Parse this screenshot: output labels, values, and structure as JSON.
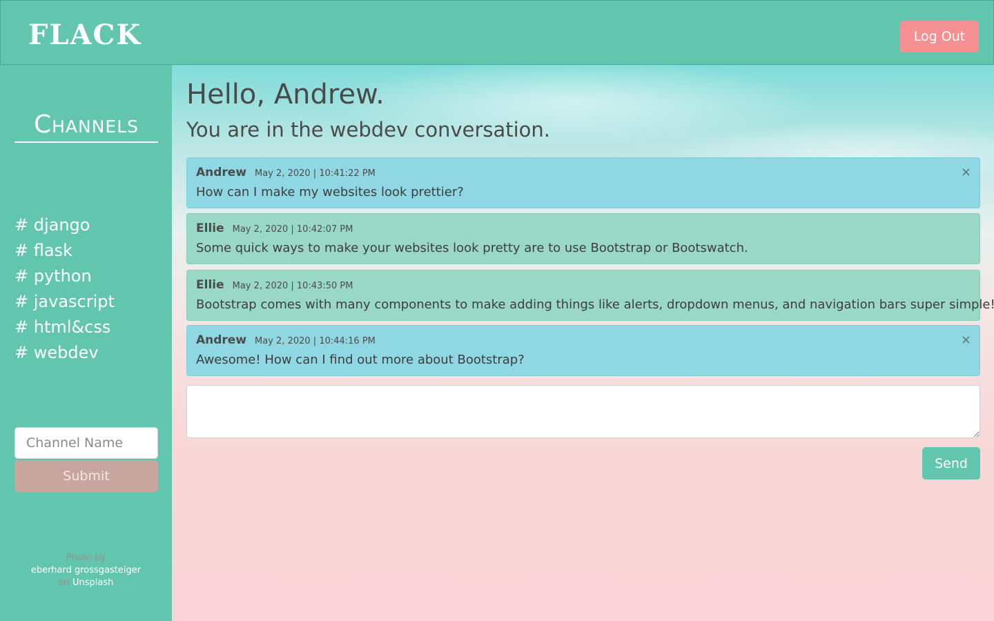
{
  "header": {
    "brand": "FLACK",
    "logout_label": "Log Out"
  },
  "sidebar": {
    "heading": "Channels",
    "channels": [
      "# django",
      "# flask",
      "# python",
      "# javascript",
      "# html&css",
      "# webdev"
    ],
    "channel_input_placeholder": "Channel Name",
    "submit_label": "Submit",
    "credit": {
      "photo_by": "Photo by",
      "author": "eberhard grossgasteiger",
      "on": "on",
      "source": "Unsplash"
    }
  },
  "main": {
    "greeting": "Hello, Andrew.",
    "subtitle": "You are in the webdev conversation.",
    "messages": [
      {
        "user": "Andrew",
        "time": "May 2, 2020 | 10:41:22 PM",
        "text": "How can I make my websites look prettier?",
        "own": true
      },
      {
        "user": "Ellie",
        "time": "May 2, 2020 | 10:42:07 PM",
        "text": "Some quick ways to make your websites look pretty are to use Bootstrap or Bootswatch.",
        "own": false
      },
      {
        "user": "Ellie",
        "time": "May 2, 2020 | 10:43:50 PM",
        "text": "Bootstrap comes with many components to make adding things like alerts, dropdown menus, and navigation bars super simple!",
        "own": false
      },
      {
        "user": "Andrew",
        "time": "May 2, 2020 | 10:44:16 PM",
        "text": "Awesome! How can I find out more about Bootstrap?",
        "own": true
      }
    ],
    "close_glyph": "×",
    "message_input_value": "",
    "send_label": "Send"
  },
  "colors": {
    "brand_green": "#61c6ad",
    "logout_pink": "#f48f92",
    "own_message": "#8fd8e3",
    "other_message": "#9ad8c6",
    "submit_muted": "#c9a5a0"
  }
}
